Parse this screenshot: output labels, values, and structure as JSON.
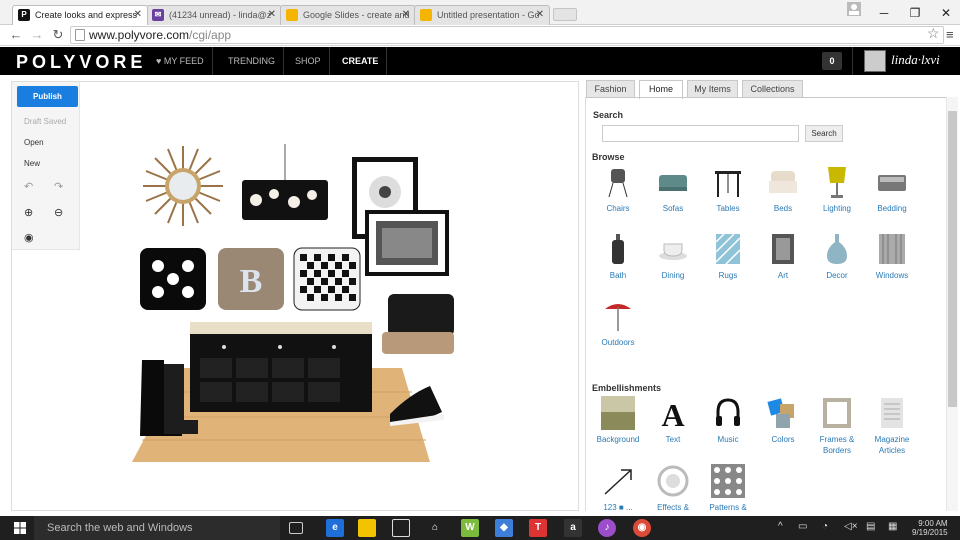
{
  "browser": {
    "tabs": [
      {
        "title": "Create looks and express",
        "favicon": "P",
        "color": "#111111"
      },
      {
        "title": "(41234 unread) - linda@z",
        "favicon": "✉",
        "color": "#6b3fa0"
      },
      {
        "title": "Google Slides - create and",
        "favicon": "▭",
        "color": "#f4b400"
      },
      {
        "title": "Untitled presentation - Go",
        "favicon": "▭",
        "color": "#f4b400"
      }
    ],
    "url_host": "www.polyvore.com",
    "url_path": "/cgi/app"
  },
  "polyvore": {
    "logo": "POLYVORE",
    "nav": [
      "♥ MY FEED",
      "TRENDING",
      "SHOP",
      "CREATE"
    ],
    "notifications": "0",
    "username": "linda·lxvi"
  },
  "tools": {
    "publish": "Publish",
    "draft_saved": "Draft Saved",
    "open": "Open",
    "new": "New"
  },
  "panel": {
    "tabs": [
      "Fashion",
      "Home",
      "My Items",
      "Collections"
    ],
    "search_label": "Search",
    "search_placeholder": "",
    "search_button": "Search",
    "browse_label": "Browse",
    "browse": [
      "Chairs",
      "Sofas",
      "Tables",
      "Beds",
      "Lighting",
      "Bedding",
      "Bath",
      "Dining",
      "Rugs",
      "Art",
      "Decor",
      "Windows",
      "Outdoors"
    ],
    "embellishments_label": "Embellishments",
    "embellishments": [
      "Background",
      "Text",
      "Music",
      "Colors",
      "Frames &\nBorders",
      "Magazine\nArticles",
      "123 ■ ...",
      "Effects &",
      "Patterns &"
    ]
  },
  "taskbar": {
    "search": "Search the web and Windows",
    "time": "9:00 AM",
    "date": "9/19/2015"
  },
  "colors": {
    "accent": "#1a7ee0",
    "link": "#2a7ab5",
    "nav_bg": "#000000",
    "taskbar_bg": "#1f1f1f"
  }
}
